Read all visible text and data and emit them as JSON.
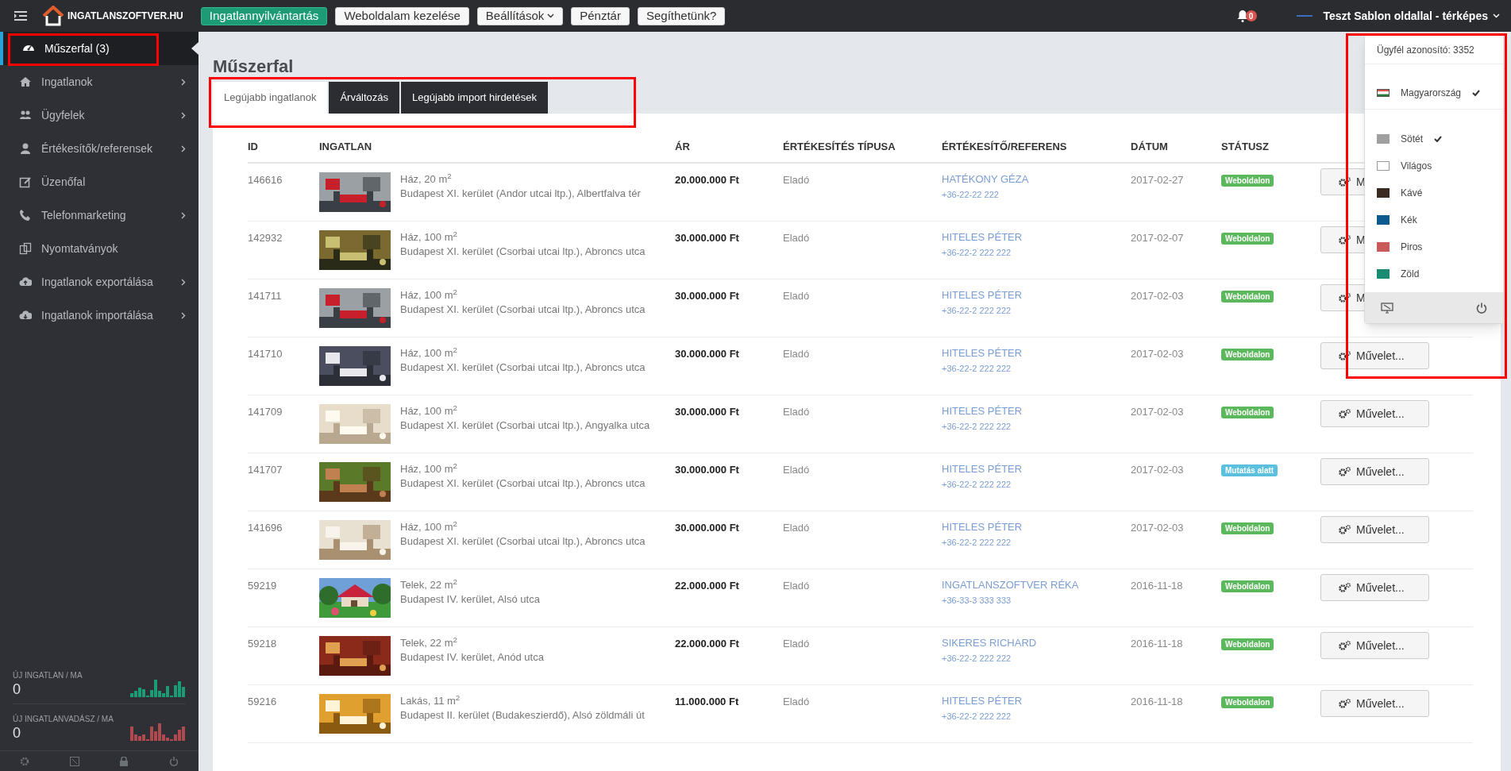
{
  "topbar": {
    "brand": "INGATLANSZOFTVER.HU",
    "nav_buttons": [
      {
        "label": "Ingatlannyilvántartás",
        "selected": true,
        "has_menu": false
      },
      {
        "label": "Weboldalam kezelése",
        "selected": false,
        "has_menu": false
      },
      {
        "label": "Beállítások",
        "selected": false,
        "has_menu": true
      },
      {
        "label": "Pénztár",
        "selected": false,
        "has_menu": false
      },
      {
        "label": "Segíthetünk?",
        "selected": false,
        "has_menu": false
      }
    ],
    "notification_count": "0",
    "account_name": "Teszt Sablon oldallal - térképes"
  },
  "sidebar": {
    "items": [
      {
        "label": "Műszerfal (3)",
        "selected": true,
        "has_submenu": false
      },
      {
        "label": "Ingatlanok",
        "selected": false,
        "has_submenu": true
      },
      {
        "label": "Ügyfelek",
        "selected": false,
        "has_submenu": true
      },
      {
        "label": "Értékesítők/referensek",
        "selected": false,
        "has_submenu": true
      },
      {
        "label": "Üzenőfal",
        "selected": false,
        "has_submenu": false
      },
      {
        "label": "Telefonmarketing",
        "selected": false,
        "has_submenu": true
      },
      {
        "label": "Nyomtatványok",
        "selected": false,
        "has_submenu": false
      },
      {
        "label": "Ingatlanok exportálása",
        "selected": false,
        "has_submenu": true
      },
      {
        "label": "Ingatlanok importálása",
        "selected": false,
        "has_submenu": true
      }
    ],
    "stats": [
      {
        "label": "ÚJ INGATLAN / MA",
        "value": "0",
        "color": "#1a9c76"
      },
      {
        "label": "ÚJ INGATLANVADÁSZ / MA",
        "value": "0",
        "color": "#b04a4e"
      }
    ]
  },
  "page": {
    "title": "Műszerfal"
  },
  "tabs": [
    {
      "label": "Legújabb ingatlanok",
      "selected": true
    },
    {
      "label": "Árváltozás",
      "selected": false
    },
    {
      "label": "Legújabb import hirdetések",
      "selected": false
    }
  ],
  "table": {
    "columns": [
      "ID",
      "INGATLAN",
      "ÁR",
      "ÉRTÉKESÍTÉS TÍPUSA",
      "ÉRTÉKESÍTŐ/REFERENS",
      "DÁTUM",
      "STÁTUSZ"
    ],
    "rows": [
      {
        "id": "146616",
        "title": "Ház, 20 m$^{2}$",
        "address": "Budapest XI. kerület (Andor utcai ltp.), Albertfalva tér",
        "price": "20.000.000 Ft",
        "sale_type": "Eladó",
        "agent": "HATÉKONY GÉZA",
        "phone": "+36-22-22 222",
        "date": "2017-02-27",
        "status": {
          "label": "Weboldalon",
          "color": "#5cb85c"
        },
        "action": "M"
      },
      {
        "id": "142932",
        "title": "Ház, 100 m$^{2}$",
        "address": "Budapest XI. kerület (Csorbai utcai ltp.), Abroncs utca",
        "price": "30.000.000 Ft",
        "sale_type": "Eladó",
        "agent": "HITELES PÉTER",
        "phone": "+36-22-2 222 222",
        "date": "2017-02-07",
        "status": {
          "label": "Weboldalon",
          "color": "#5cb85c"
        },
        "action": "M"
      },
      {
        "id": "141711",
        "title": "Ház, 100 m$^{2}$",
        "address": "Budapest XI. kerület (Csorbai utcai ltp.), Abroncs utca",
        "price": "30.000.000 Ft",
        "sale_type": "Eladó",
        "agent": "HITELES PÉTER",
        "phone": "+36-22-2 222 222",
        "date": "2017-02-03",
        "status": {
          "label": "Weboldalon",
          "color": "#5cb85c"
        },
        "action": "M"
      },
      {
        "id": "141710",
        "title": "Ház, 100 m$^{2}$",
        "address": "Budapest XI. kerület (Csorbai utcai ltp.), Abroncs utca",
        "price": "30.000.000 Ft",
        "sale_type": "Eladó",
        "agent": "HITELES PÉTER",
        "phone": "+36-22-2 222 222",
        "date": "2017-02-03",
        "status": {
          "label": "Weboldalon",
          "color": "#5cb85c"
        },
        "action": "Művelet..."
      },
      {
        "id": "141709",
        "title": "Ház, 100 m$^{2}$",
        "address": "Budapest XI. kerület (Csorbai utcai ltp.), Angyalka utca",
        "price": "30.000.000 Ft",
        "sale_type": "Eladó",
        "agent": "HITELES PÉTER",
        "phone": "+36-22-2 222 222",
        "date": "2017-02-03",
        "status": {
          "label": "Weboldalon",
          "color": "#5cb85c"
        },
        "action": "Művelet..."
      },
      {
        "id": "141707",
        "title": "Ház, 100 m$^{2}$",
        "address": "Budapest XI. kerület (Csorbai utcai ltp.), Abroncs utca",
        "price": "30.000.000 Ft",
        "sale_type": "Eladó",
        "agent": "HITELES PÉTER",
        "phone": "+36-22-2 222 222",
        "date": "2017-02-03",
        "status": {
          "label": "Mutatás alatt",
          "color": "#5bc0de"
        },
        "action": "Művelet..."
      },
      {
        "id": "141696",
        "title": "Ház, 100 m$^{2}$",
        "address": "Budapest XI. kerület (Csorbai utcai ltp.), Abroncs utca",
        "price": "30.000.000 Ft",
        "sale_type": "Eladó",
        "agent": "HITELES PÉTER",
        "phone": "+36-22-2 222 222",
        "date": "2017-02-03",
        "status": {
          "label": "Weboldalon",
          "color": "#5cb85c"
        },
        "action": "Művelet..."
      },
      {
        "id": "59219",
        "title": "Telek, 22 m$^{2}$",
        "address": "Budapest IV. kerület, Alsó utca",
        "price": "22.000.000 Ft",
        "sale_type": "Eladó",
        "agent": "INGATLANSZOFTVER RÉKA",
        "phone": "+36-33-3 333 333",
        "date": "2016-11-18",
        "status": {
          "label": "Weboldalon",
          "color": "#5cb85c"
        },
        "action": "Művelet..."
      },
      {
        "id": "59218",
        "title": "Telek, 22 m$^{2}$",
        "address": "Budapest IV. kerület, Anód utca",
        "price": "22.000.000 Ft",
        "sale_type": "Eladó",
        "agent": "SIKERES RICHARD",
        "phone": "+36-22-2 222 222",
        "date": "2016-11-18",
        "status": {
          "label": "Weboldalon",
          "color": "#5cb85c"
        },
        "action": "Művelet..."
      },
      {
        "id": "59216",
        "title": "Lakás, 11 m$^{2}$",
        "address": "Budapest II. kerület (Budakeszierdő), Alsó zöldmáli út",
        "price": "11.000.000 Ft",
        "sale_type": "Eladó",
        "agent": "HITELES PÉTER",
        "phone": "+36-22-2 222 222",
        "date": "2016-11-18",
        "status": {
          "label": "Weboldalon",
          "color": "#5cb85c"
        },
        "action": "Művelet..."
      }
    ]
  },
  "account_menu": {
    "client_id": "Ügyfél azonosító: 3352",
    "languages": [
      {
        "label": "Magyarország",
        "selected": true
      }
    ],
    "themes": [
      {
        "label": "Sötét",
        "color": "#a0a0a0",
        "selected": true
      },
      {
        "label": "Világos",
        "color": "#ffffff",
        "selected": false
      },
      {
        "label": "Kávé",
        "color": "#3a2a22",
        "selected": false
      },
      {
        "label": "Kék",
        "color": "#0d5a8e",
        "selected": false
      },
      {
        "label": "Piros",
        "color": "#c85a5a",
        "selected": false
      },
      {
        "label": "Zöld",
        "color": "#1a8c72",
        "selected": false
      }
    ]
  }
}
